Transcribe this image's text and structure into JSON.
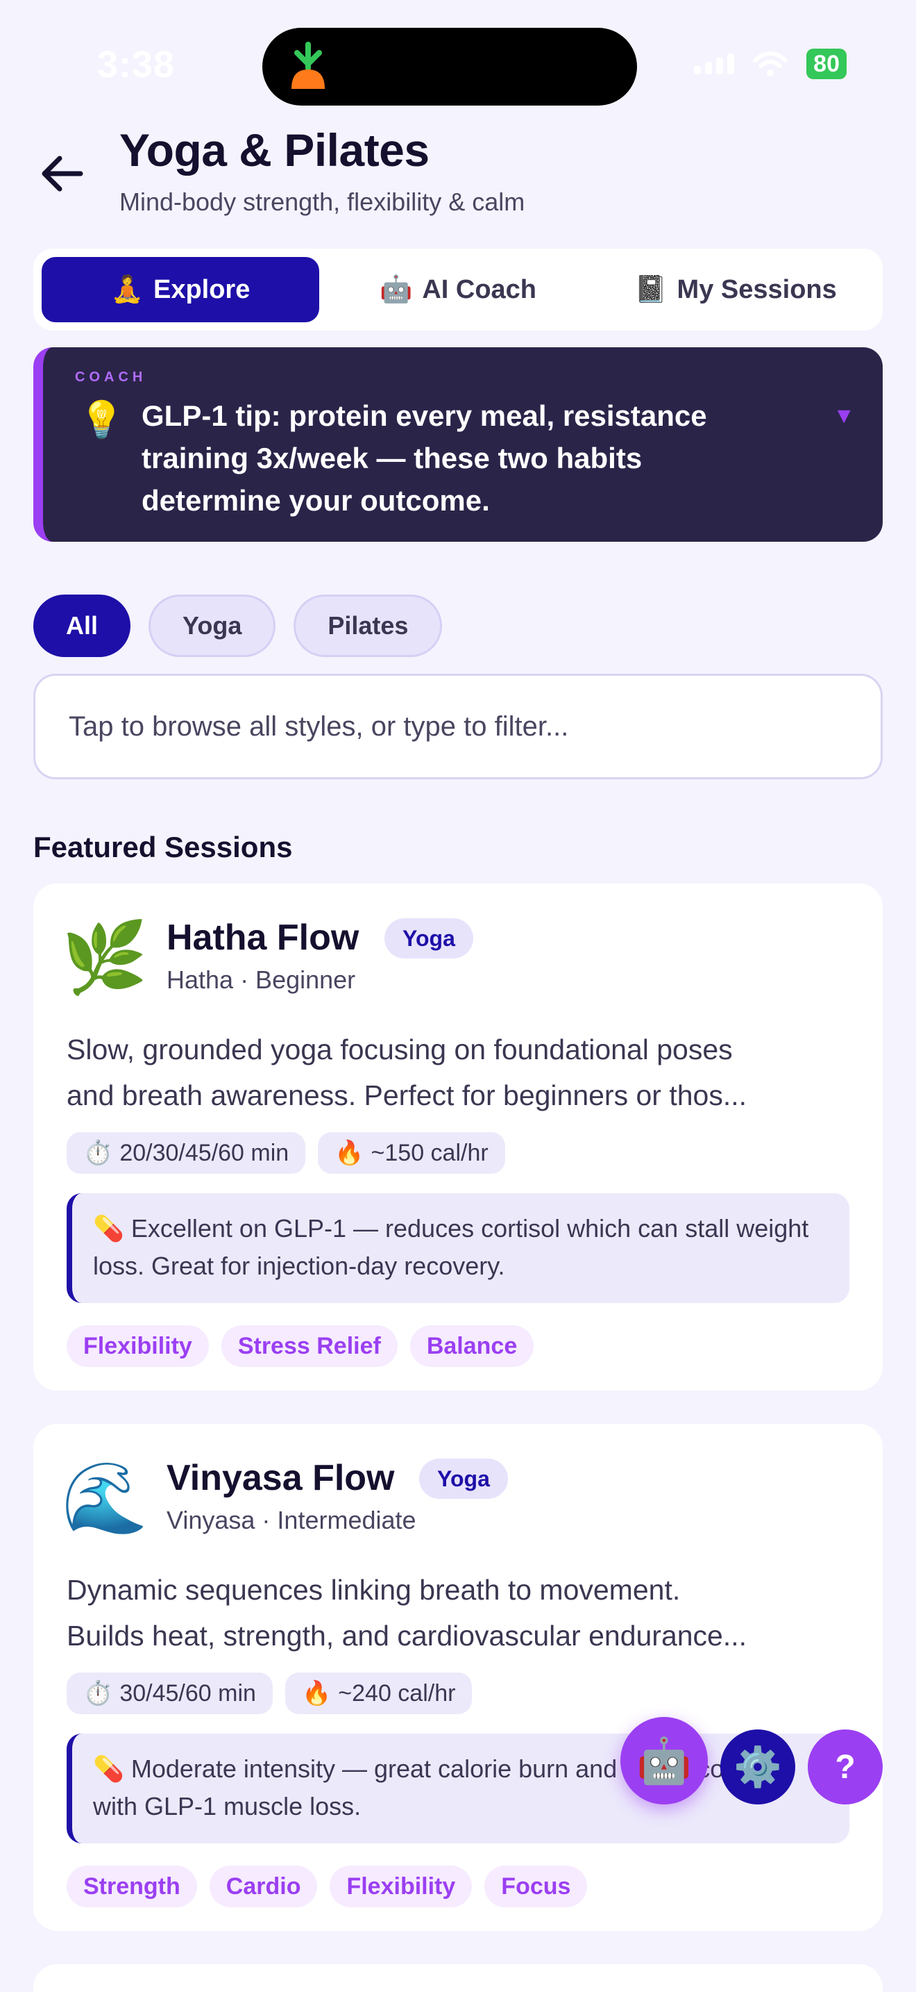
{
  "status_bar": {
    "time": "3:38",
    "battery": "80"
  },
  "header": {
    "title": "Yoga & Pilates",
    "subtitle": "Mind-body strength, flexibility & calm"
  },
  "tabs": [
    {
      "emoji": "🧘",
      "label": "Explore",
      "active": true
    },
    {
      "emoji": "🤖",
      "label": "AI Coach",
      "active": false
    },
    {
      "emoji": "📓",
      "label": "My Sessions",
      "active": false
    }
  ],
  "coach_tip": {
    "label": "COACH",
    "icon": "💡",
    "text": "GLP-1 tip: protein every meal, resistance training 3x/week — these two habits determine your outcome.",
    "chevron": "▼"
  },
  "filters": [
    {
      "label": "All",
      "active": true
    },
    {
      "label": "Yoga",
      "active": false
    },
    {
      "label": "Pilates",
      "active": false
    }
  ],
  "search": {
    "placeholder": "Tap to browse all styles, or type to filter..."
  },
  "section_title": "Featured Sessions",
  "sessions": [
    {
      "icon": "🌿",
      "title": "Hatha Flow",
      "badge": "Yoga",
      "subtitle": "Hatha · Beginner",
      "desc_line1": "Slow, grounded yoga focusing on foundational poses",
      "desc_line2": "and breath awareness. Perfect for beginners or thos...",
      "duration": "20/30/45/60 min",
      "calories": "~150 cal/hr",
      "glp_note": "Excellent on GLP-1 — reduces cortisol which can stall weight loss. Great for injection-day recovery.",
      "tags": [
        "Flexibility",
        "Stress Relief",
        "Balance"
      ]
    },
    {
      "icon": "🌊",
      "title": "Vinyasa Flow",
      "badge": "Yoga",
      "subtitle": "Vinyasa · Intermediate",
      "desc_line1": "Dynamic sequences linking breath to movement.",
      "desc_line2": "Builds heat, strength, and cardiovascular endurance...",
      "duration": "30/45/60 min",
      "calories": "~240 cal/hr",
      "glp_note": "Moderate intensity — great calorie burn and stress common with GLP-1 muscle loss.",
      "tags": [
        "Strength",
        "Cardio",
        "Flexibility",
        "Focus"
      ]
    }
  ],
  "icons": {
    "timer": "⏱️",
    "fire": "🔥",
    "pill": "💊",
    "robot": "🤖",
    "gear": "⚙️",
    "help": "?"
  },
  "colors": {
    "primary": "#1e0fa8",
    "accent": "#9b3ff2",
    "coach_bg": "#2b2449",
    "background": "#f5f3fd"
  }
}
